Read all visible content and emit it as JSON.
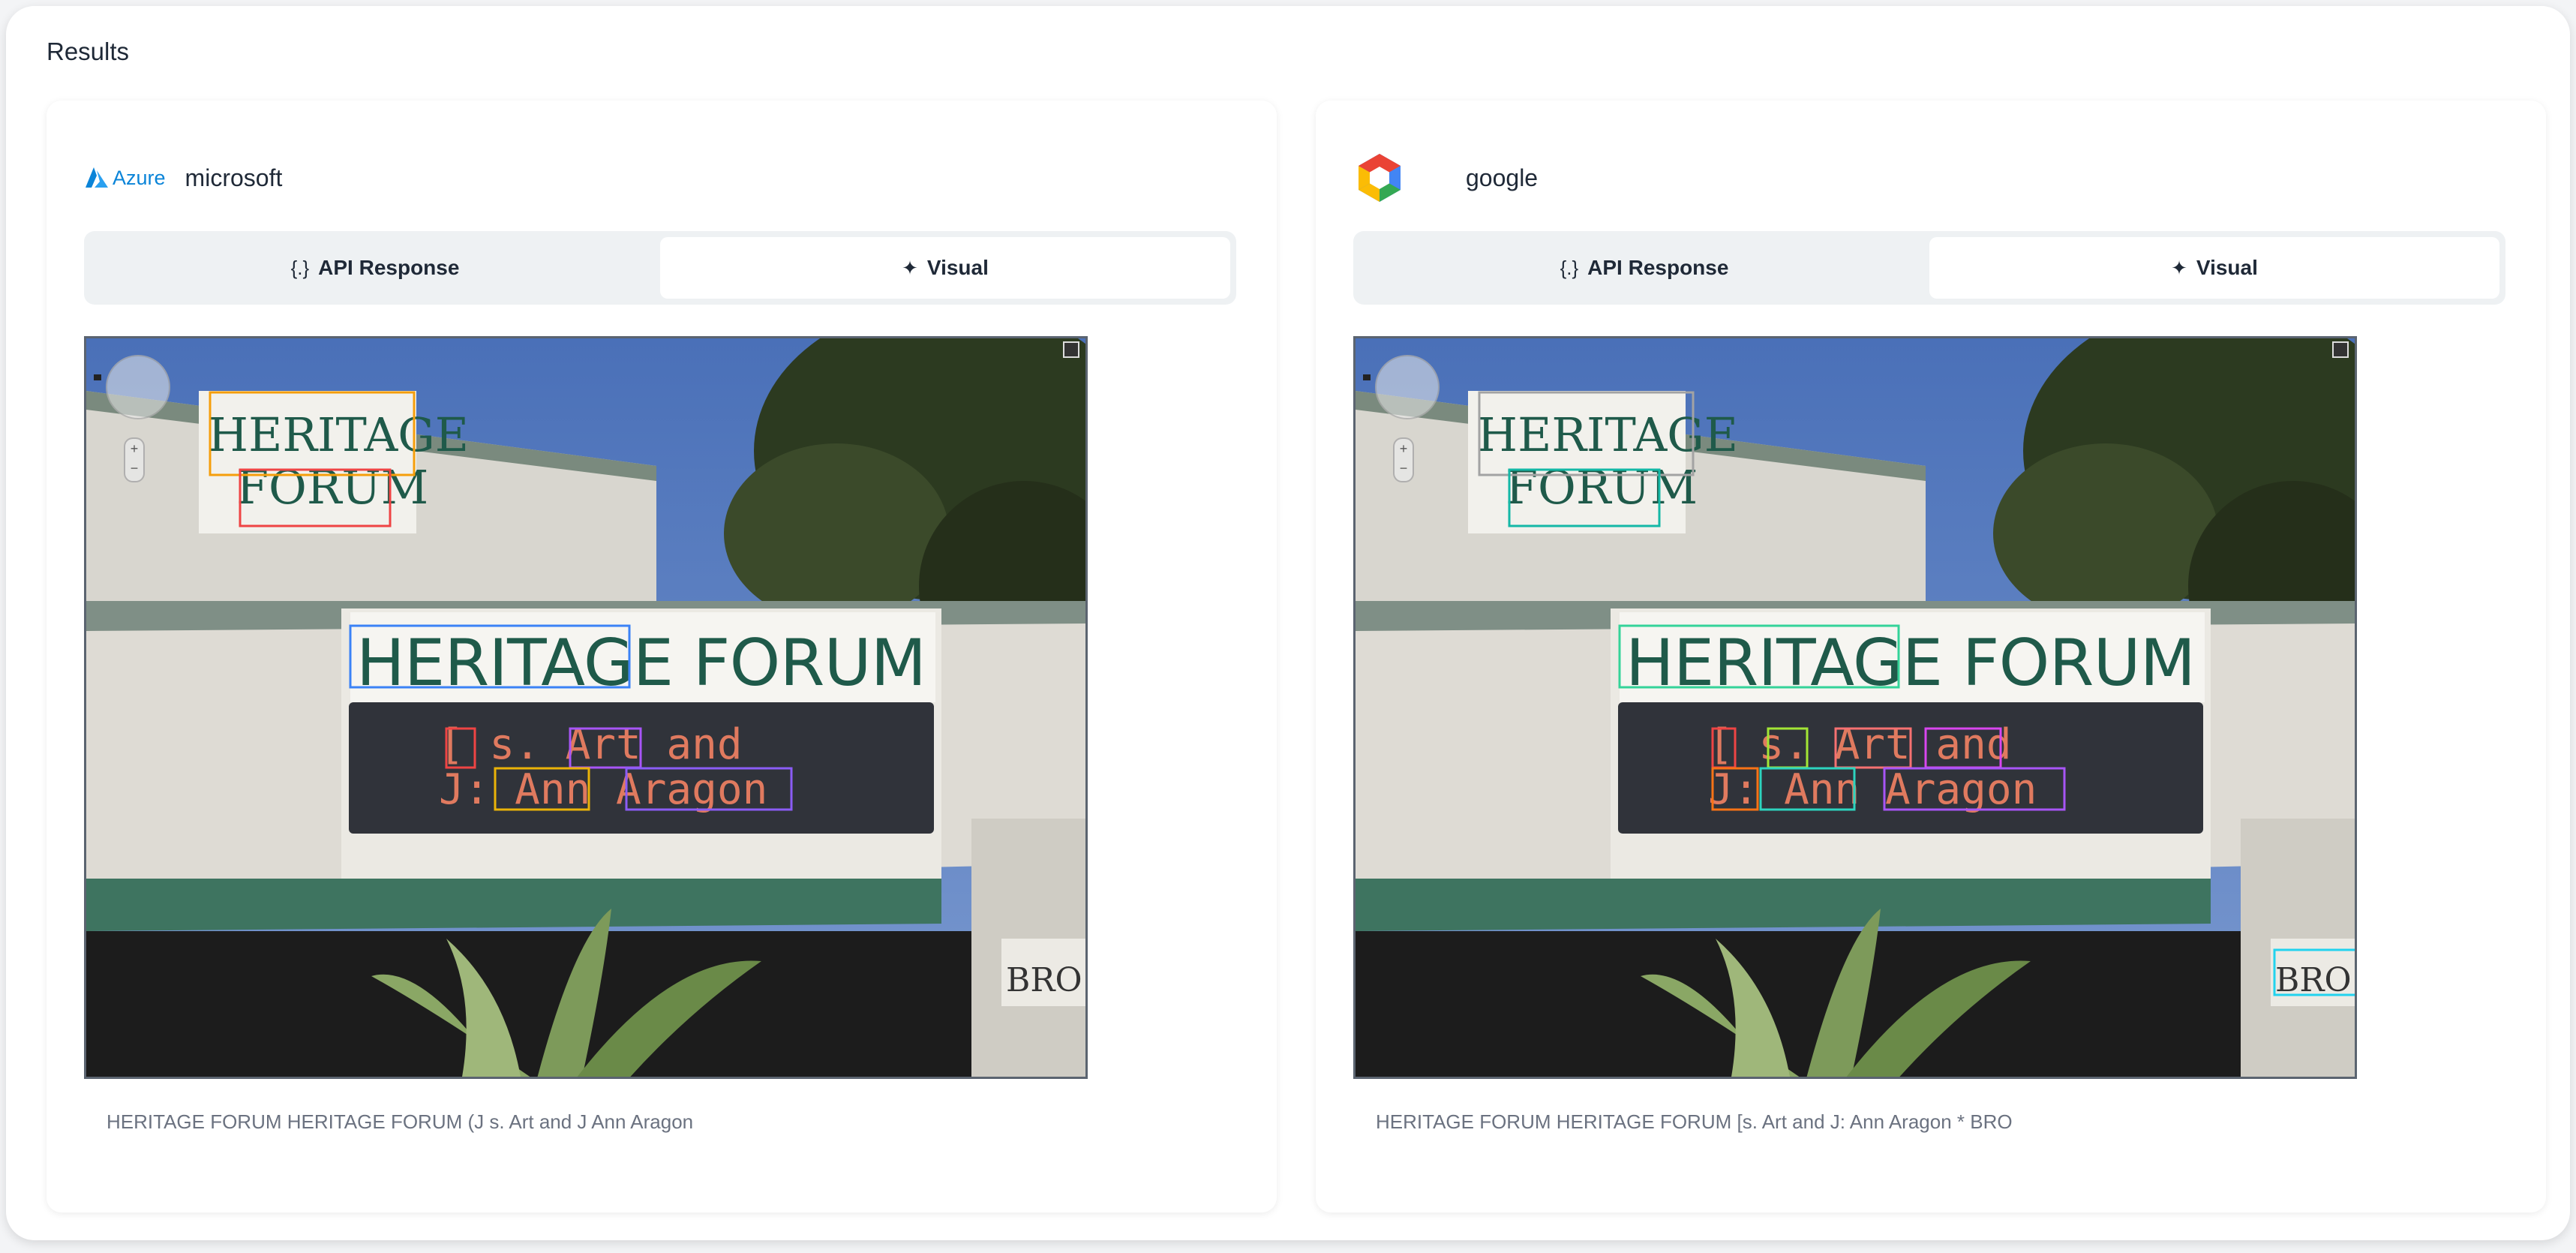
{
  "page": {
    "section_title": "Results"
  },
  "panels": [
    {
      "provider": "microsoft",
      "logo_text": "Azure",
      "tabs": [
        {
          "icon": "{.}",
          "label": "API Response",
          "active": false
        },
        {
          "icon": "✦",
          "label": "Visual",
          "active": true
        }
      ],
      "ocr_result": "HERITAGE FORUM HERITAGE FORUM (J s. Art and J Ann Aragon"
    },
    {
      "provider": "google",
      "tabs": [
        {
          "icon": "{.}",
          "label": "API Response",
          "active": false
        },
        {
          "icon": "✦",
          "label": "Visual",
          "active": true
        }
      ],
      "ocr_result": "HERITAGE FORUM HERITAGE FORUM [s. Art and J: Ann Aragon * BRO"
    }
  ],
  "scene": {
    "small_sign_lines": [
      "HERITAGE",
      "FORUM"
    ],
    "big_sign": "HERITAGE FORUM",
    "marquee_line1": "[ s. Art and",
    "marquee_line2": "J: Ann Aragon",
    "side_sign": "BRO"
  }
}
